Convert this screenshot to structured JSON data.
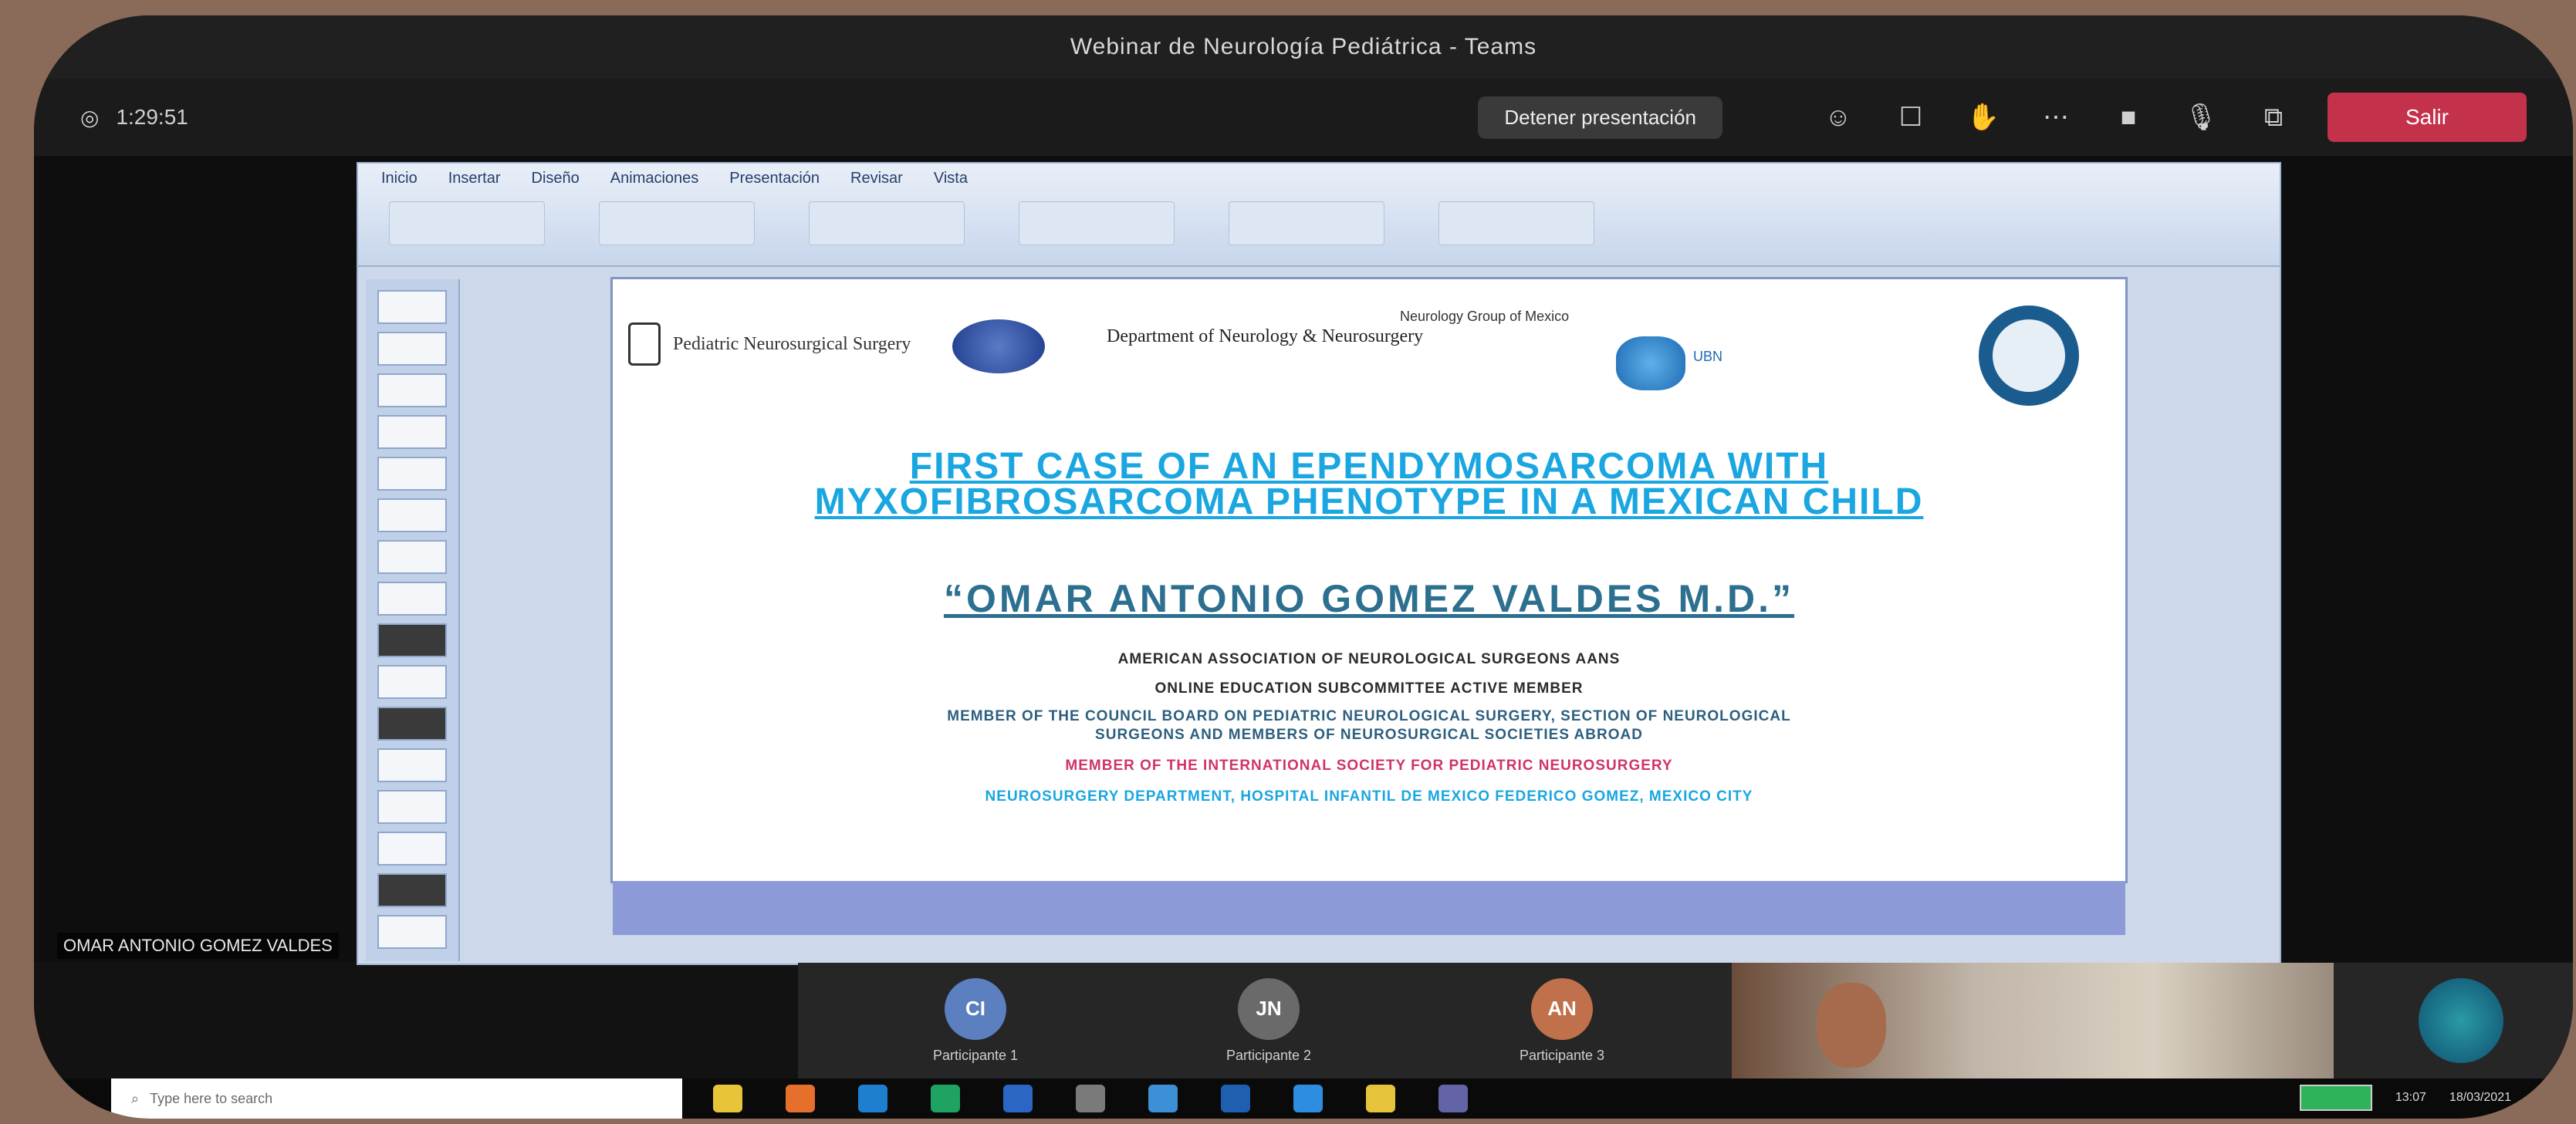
{
  "window": {
    "title": "Webinar de Neurología Pediátrica - Teams"
  },
  "toolbar": {
    "timer": "1:29:51",
    "stop_sharing": "Detener presentación",
    "leave": "Salir"
  },
  "ppt": {
    "tabs": [
      "Inicio",
      "Insertar",
      "Diseño",
      "Animaciones",
      "Presentación",
      "Revisar",
      "Vista"
    ]
  },
  "slide": {
    "logo_university": "Pediatric Neurosurgical Surgery",
    "logo_department": "Department of Neurology & Neurosurgery",
    "note": "Neurology Group of Mexico",
    "brain_logo_text": "UBN",
    "title_line1": "FIRST CASE OF AN EPENDYMOSARCOMA WITH",
    "title_line2": "MYXOFIBROSARCOMA PHENOTYPE IN A MEXICAN CHILD",
    "author": "“OMAR ANTONIO GOMEZ VALDES M.D.”",
    "lines": [
      "AMERICAN ASSOCIATION OF NEUROLOGICAL SURGEONS AANS",
      "ONLINE EDUCATION SUBCOMMITTEE ACTIVE MEMBER",
      "MEMBER OF THE COUNCIL BOARD ON PEDIATRIC NEUROLOGICAL SURGERY, SECTION OF NEUROLOGICAL",
      "SURGEONS AND MEMBERS OF NEUROSURGICAL SOCIETIES ABROAD",
      "MEMBER OF THE INTERNATIONAL SOCIETY FOR PEDIATRIC NEUROSURGERY",
      "NEUROSURGERY DEPARTMENT, HOSPITAL INFANTIL DE MEXICO FEDERICO GOMEZ, MEXICO CITY"
    ]
  },
  "presenter_label": "OMAR ANTONIO GOMEZ VALDES",
  "participants": [
    {
      "initials": "CI",
      "name": "Participante 1",
      "color": "#5b7fbf"
    },
    {
      "initials": "JN",
      "name": "Participante 2",
      "color": "#6a6a6a"
    },
    {
      "initials": "AN",
      "name": "Participante 3",
      "color": "#c0704a"
    }
  ],
  "taskbar": {
    "search_placeholder": "Type here to search",
    "time": "13:07",
    "date": "18/03/2021"
  }
}
